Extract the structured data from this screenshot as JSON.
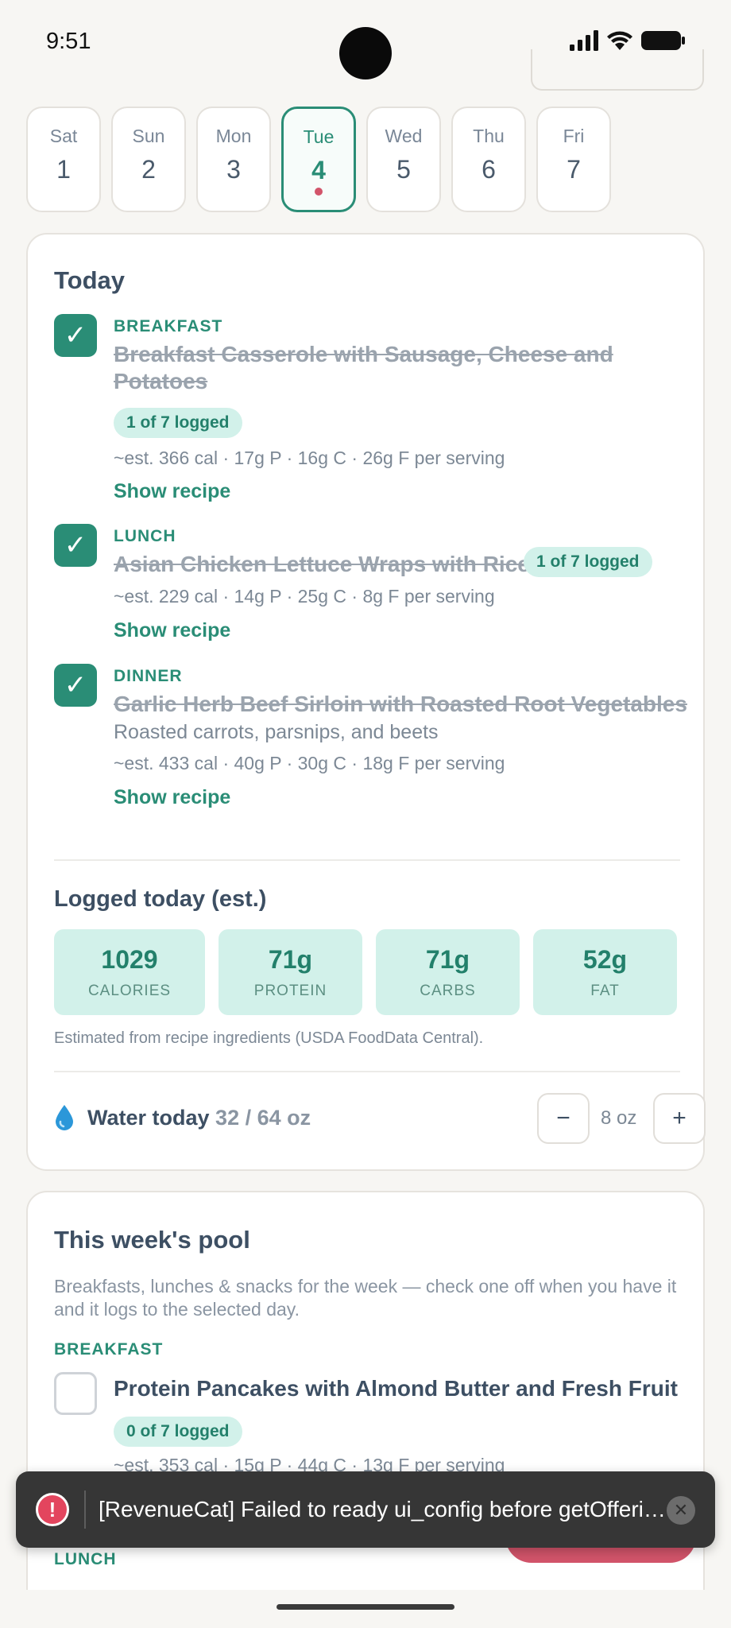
{
  "status_bar": {
    "time": "9:51"
  },
  "week": {
    "days": [
      {
        "dow": "Sat",
        "num": "1"
      },
      {
        "dow": "Sun",
        "num": "2"
      },
      {
        "dow": "Mon",
        "num": "3"
      },
      {
        "dow": "Tue",
        "num": "4"
      },
      {
        "dow": "Wed",
        "num": "5"
      },
      {
        "dow": "Thu",
        "num": "6"
      },
      {
        "dow": "Fri",
        "num": "7"
      }
    ],
    "selected": "Tue"
  },
  "today": {
    "title": "Today",
    "meals": [
      {
        "label": "BREAKFAST",
        "title_line1": "Breakfast Casserole with Sausage, Cheese and",
        "title_line2": "Potatoes",
        "logged": "1 of 7 logged",
        "nutrition": "~est. 366 cal · 17g P · 16g C · 26g F per serving",
        "show_recipe": "Show recipe",
        "checked": true
      },
      {
        "label": "LUNCH",
        "title_line1": "Asian Chicken Lettuce Wraps with Rice",
        "logged": "1 of 7 logged",
        "nutrition": "~est. 229 cal · 14g P · 25g C · 8g F per serving",
        "show_recipe": "Show recipe",
        "checked": true
      },
      {
        "label": "DINNER",
        "title_line1": "Garlic Herb Beef Sirloin with Roasted Root Vegetables",
        "description": "Roasted carrots, parsnips, and beets",
        "nutrition": "~est. 433 cal · 40g P · 30g C · 18g F per serving",
        "show_recipe": "Show recipe",
        "checked": true
      }
    ],
    "checkmark": "✓"
  },
  "logged_today": {
    "title": "Logged today (est.)",
    "macros": [
      {
        "value": "1029",
        "label": "CALORIES"
      },
      {
        "value": "71g",
        "label": "PROTEIN"
      },
      {
        "value": "71g",
        "label": "CARBS"
      },
      {
        "value": "52g",
        "label": "FAT"
      }
    ],
    "source_note": "Estimated from recipe ingredients (USDA FoodData Central)."
  },
  "water": {
    "label": "Water today",
    "value": "32 / 64 oz",
    "minus": "−",
    "plus": "+",
    "step": "8 oz"
  },
  "pool": {
    "title": "This week's pool",
    "description": "Breakfasts, lunches & snacks for the week — check one off when you have it and it logs to the selected day.",
    "section_breakfast": "BREAKFAST",
    "item": {
      "title": "Protein Pancakes with Almond Butter and Fresh Fruit",
      "logged": "0 of 7 logged",
      "nutrition": "~est. 353 cal · 15g P · 44g C · 13g F per serving"
    },
    "section_lunch": "LUNCH"
  },
  "toast": {
    "icon": "!",
    "message": "[RevenueCat] Failed to ready ui_config before getOfferings",
    "close": "✕"
  },
  "colors": {
    "accent": "#2a8d76",
    "accent_light": "#d2f1ea",
    "danger": "#d2546a",
    "background": "#f7f6f3"
  }
}
